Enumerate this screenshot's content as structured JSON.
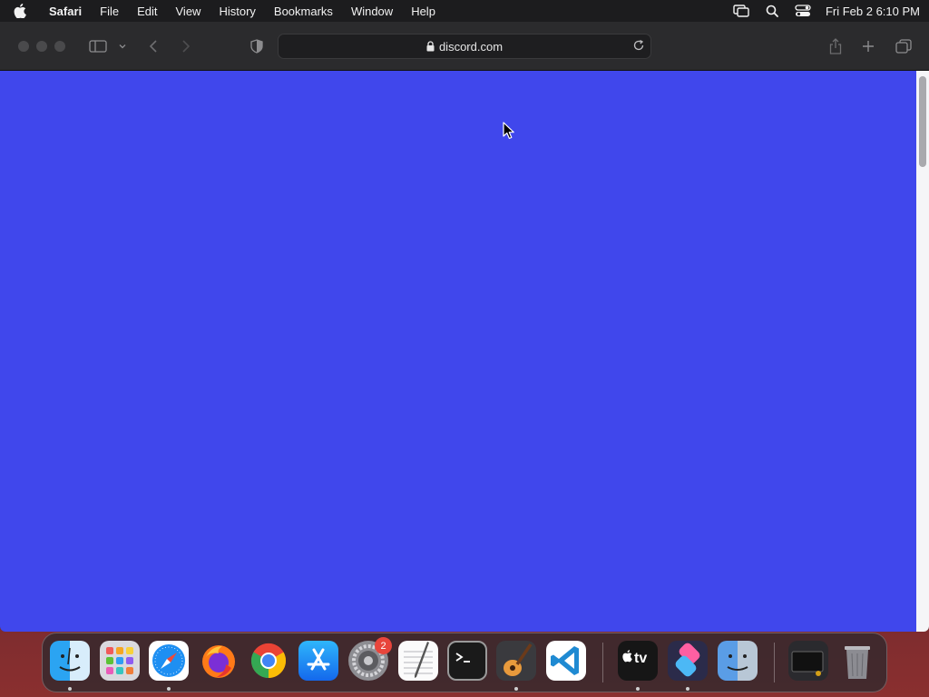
{
  "menubar": {
    "app_name": "Safari",
    "items": [
      "File",
      "Edit",
      "View",
      "History",
      "Bookmarks",
      "Window",
      "Help"
    ],
    "clock": "Fri Feb 2  6:10 PM"
  },
  "browser": {
    "url": "discord.com",
    "page_background": "#4047ec"
  },
  "dock": {
    "apps": [
      "Finder",
      "Launchpad",
      "Safari",
      "Firefox",
      "Google Chrome",
      "App Store",
      "System Settings",
      "TextEdit",
      "Terminal",
      "GarageBand",
      "Visual Studio Code",
      "Apple TV",
      "Shortcuts",
      "Migration Assistant",
      "Screenshot",
      "Trash"
    ],
    "settings_badge": "2",
    "tv_label": "tv"
  }
}
